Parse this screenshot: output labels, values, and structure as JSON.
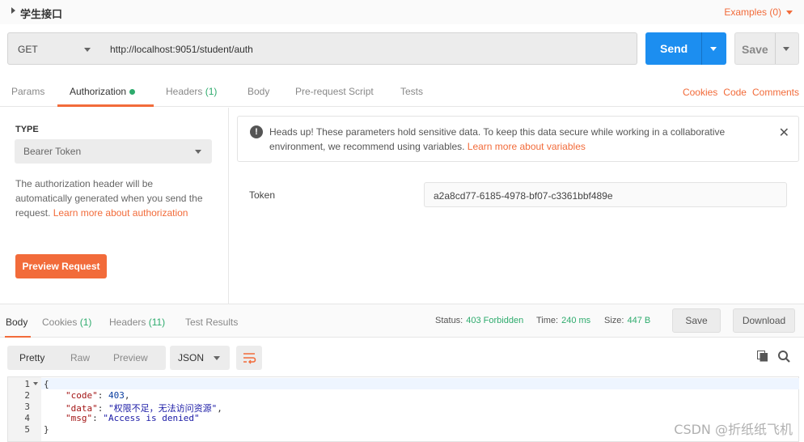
{
  "title": "学生接口",
  "examples": "Examples (0)",
  "request": {
    "method": "GET",
    "url": "http://localhost:9051/student/auth",
    "send": "Send",
    "save": "Save"
  },
  "tabs": [
    {
      "label": "Params",
      "count": ""
    },
    {
      "label": "Authorization",
      "count": ""
    },
    {
      "label": "Headers",
      "count": "(1)"
    },
    {
      "label": "Body",
      "count": ""
    },
    {
      "label": "Pre-request Script",
      "count": ""
    },
    {
      "label": "Tests",
      "count": ""
    }
  ],
  "right_links": [
    "Cookies",
    "Code",
    "Comments"
  ],
  "auth": {
    "type_label": "TYPE",
    "type_value": "Bearer Token",
    "desc": "The authorization header will be automatically generated when you send the request. ",
    "desc_link": "Learn more about authorization",
    "preview_button": "Preview Request",
    "alert_text": "Heads up! These parameters hold sensitive data. To keep this data secure while working in a collaborative environment, we recommend using variables. ",
    "alert_link": "Learn more about variables",
    "token_label": "Token",
    "token_value": "a2a8cd77-6185-4978-bf07-c3361bbf489e"
  },
  "response": {
    "tabs": [
      {
        "label": "Body",
        "count": ""
      },
      {
        "label": "Cookies",
        "count": "(1)"
      },
      {
        "label": "Headers",
        "count": "(11)"
      },
      {
        "label": "Test Results",
        "count": ""
      }
    ],
    "status_label": "Status:",
    "status_value": "403 Forbidden",
    "time_label": "Time:",
    "time_value": "240 ms",
    "size_label": "Size:",
    "size_value": "447 B",
    "save": "Save",
    "download": "Download",
    "formats": [
      "Pretty",
      "Raw",
      "Preview"
    ],
    "format_select": "JSON",
    "lines": [
      {
        "n": "1",
        "text": "{"
      },
      {
        "n": "2",
        "key": "\"code\"",
        "value": "403",
        "vtype": "n",
        "comma": ","
      },
      {
        "n": "3",
        "key": "\"data\"",
        "value": "\"权限不足，无法访问资源\"",
        "vtype": "s",
        "comma": ","
      },
      {
        "n": "4",
        "key": "\"msg\"",
        "value": "\"Access is denied\"",
        "vtype": "s",
        "comma": ""
      },
      {
        "n": "5",
        "text": "}"
      }
    ]
  },
  "watermark": "CSDN @折纸纸飞机",
  "colors": {
    "accent": "#f26b3a",
    "send": "#1c8ef0",
    "ok": "#2eab6d"
  }
}
